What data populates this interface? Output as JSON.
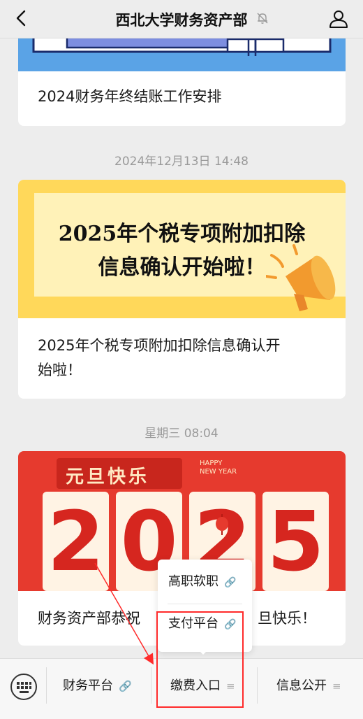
{
  "header": {
    "title": "西北大学财务资产部"
  },
  "articles": [
    {
      "title": "2024财务年终结账工作安排"
    },
    {
      "timestamp": "2024年12月13日 14:48",
      "banner_lines": [
        "2025年个税专项附加扣除",
        "信息确认开始啦！"
      ],
      "title_line1": "2025年个税专项附加扣除信息确认开",
      "title_line2": "始啦！"
    },
    {
      "timestamp": "星期三 08:04",
      "banner_greeting": "元旦快乐",
      "banner_happy": "HAPPY",
      "banner_newyear": "NEW YEAR",
      "banner_digits": [
        "2",
        "0",
        "2",
        "5"
      ],
      "title_left": "财务资产部恭祝",
      "title_right": "旦快乐！"
    }
  ],
  "menu": {
    "tabs": [
      {
        "label": "财务平台",
        "suffix": "🔗"
      },
      {
        "label": "缴费入口",
        "suffix": "≡"
      },
      {
        "label": "信息公开",
        "suffix": "≡"
      }
    ],
    "popup_items": [
      {
        "label": "高职软职",
        "suffix": "🔗"
      },
      {
        "label": "支付平台",
        "suffix": "🔗"
      }
    ]
  },
  "colors": {
    "accent_red": "#ff2a2a",
    "banner_yellow": "#ffe37a",
    "banner_red": "#e63a2e"
  }
}
